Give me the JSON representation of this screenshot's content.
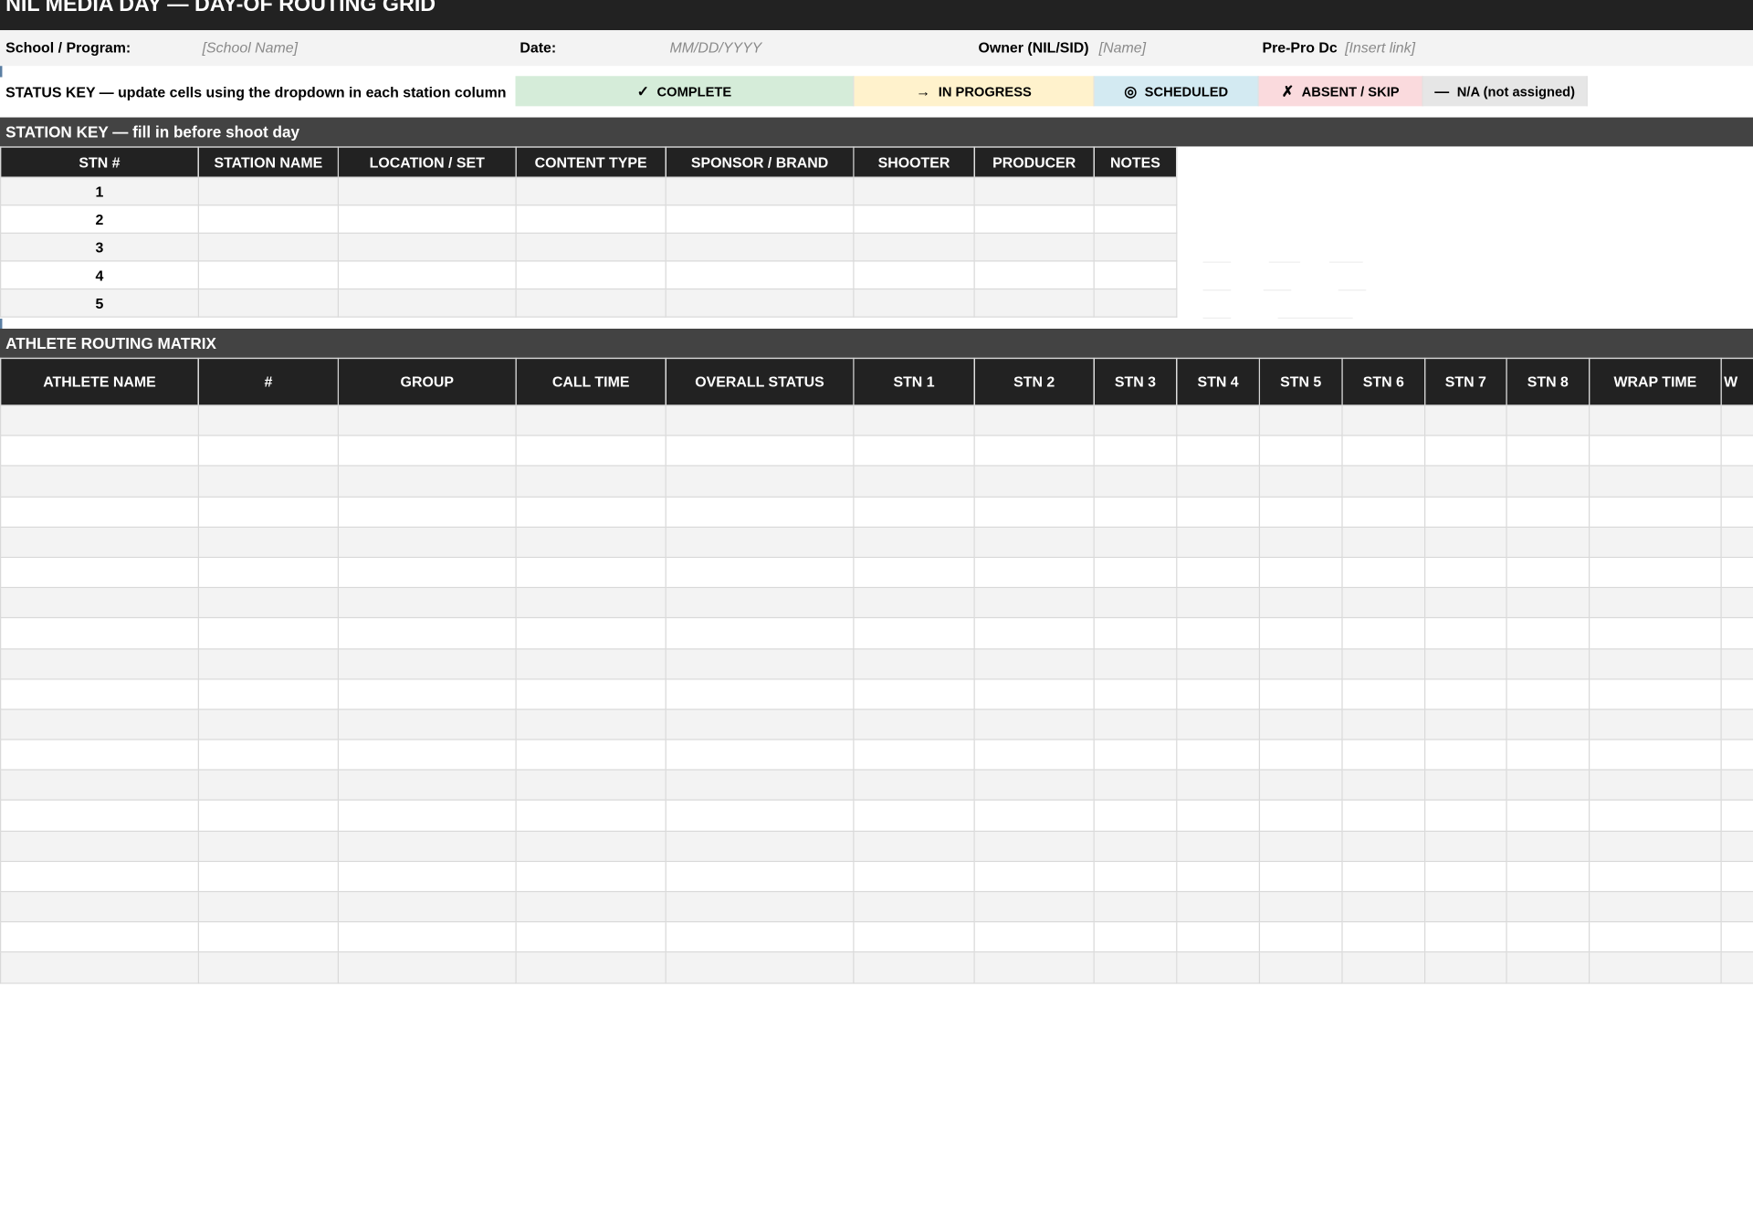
{
  "title": "NIL MEDIA DAY — DAY-OF ROUTING GRID",
  "info": {
    "school_label": "School / Program:",
    "school_value": "[School Name]",
    "date_label": "Date:",
    "date_value": "MM/DD/YYYY",
    "owner_label": "Owner (NIL/SID)",
    "owner_value": "[Name]",
    "prepro_label": "Pre-Pro Dc",
    "prepro_value": "[Insert link]"
  },
  "status_key": {
    "intro": "STATUS KEY — update cells using the dropdown in each station column",
    "items": [
      {
        "glyph": "✓",
        "label": "COMPLETE",
        "color": "#d5ecd9"
      },
      {
        "glyph": "→",
        "label": "IN PROGRESS",
        "color": "#fff2cc"
      },
      {
        "glyph": "◎",
        "label": "SCHEDULED",
        "color": "#d3eaf2"
      },
      {
        "glyph": "✗",
        "label": "ABSENT / SKIP",
        "color": "#fadadd"
      },
      {
        "glyph": "—",
        "label": "N/A (not assigned)",
        "color": "#e6e6e6"
      }
    ]
  },
  "station_key": {
    "title": "STATION KEY — fill in before shoot day",
    "headers": [
      "STN #",
      "STATION NAME",
      "LOCATION / SET",
      "CONTENT TYPE",
      "SPONSOR / BRAND",
      "SHOOTER",
      "PRODUCER",
      "NOTES"
    ],
    "rows": [
      [
        "1",
        "",
        "",
        "",
        "",
        "",
        "",
        ""
      ],
      [
        "2",
        "",
        "",
        "",
        "",
        "",
        "",
        ""
      ],
      [
        "3",
        "",
        "",
        "",
        "",
        "",
        "",
        ""
      ],
      [
        "4",
        "",
        "",
        "",
        "",
        "",
        "",
        ""
      ],
      [
        "5",
        "",
        "",
        "",
        "",
        "",
        "",
        ""
      ]
    ]
  },
  "matrix": {
    "title": "ATHLETE ROUTING MATRIX",
    "headers": [
      "ATHLETE NAME",
      "#",
      "GROUP",
      "CALL TIME",
      "OVERALL STATUS",
      "STN 1",
      "STN 2",
      "STN 3",
      "STN 4",
      "STN 5",
      "STN 6",
      "STN 7",
      "STN 8",
      "WRAP TIME",
      "W"
    ],
    "row_count": 19
  },
  "colors": {
    "header_dark": "#222222",
    "section_bar": "#434343",
    "row_alt": "#f3f3f3",
    "placeholder_text": "#8a8a8a"
  }
}
